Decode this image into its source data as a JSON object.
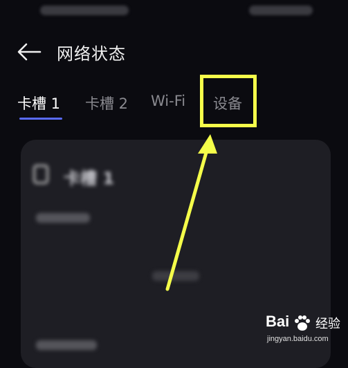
{
  "header": {
    "title": "网络状态",
    "back_icon": "arrow-left-icon"
  },
  "tabs": [
    {
      "label": "卡槽 1",
      "active": true
    },
    {
      "label": "卡槽 2",
      "active": false
    },
    {
      "label": "Wi-Fi",
      "active": false
    },
    {
      "label": "设备",
      "active": false
    }
  ],
  "card": {
    "title": "卡槽 1",
    "icon": "sim-card-icon"
  },
  "annotation": {
    "highlight_color": "#f5ff4a",
    "pointer": "arrow-icon"
  },
  "watermark": {
    "brand": "Bai",
    "brand_cn": "经验",
    "url": "jingyan.baidu.com"
  },
  "colors": {
    "background": "#0b0b10",
    "tab_accent": "#5a6bff",
    "card": "#1e1e24"
  }
}
